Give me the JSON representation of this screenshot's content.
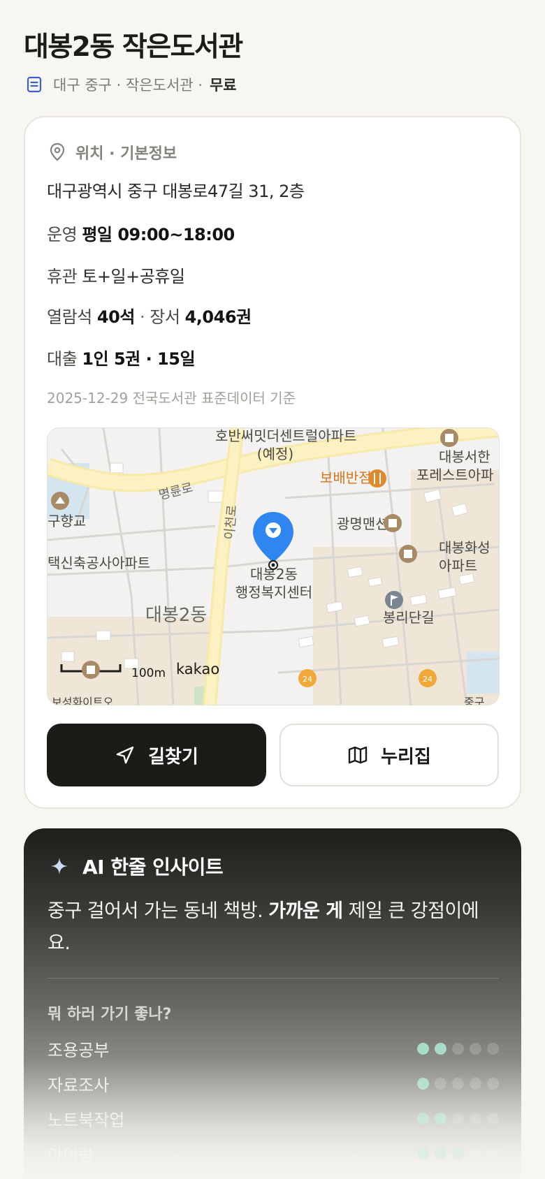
{
  "header": {
    "title": "대봉2동 작은도서관",
    "meta": "대구 중구 · 작은도서관 ·",
    "price": "무료"
  },
  "info": {
    "section_title": "위치 · 기본정보",
    "address": "대구광역시 중구 대봉로47길 31, 2층",
    "hours_label": "운영",
    "hours_value": "평일 09:00~18:00",
    "closed_label": "휴관",
    "closed_value": "토+일+공휴일",
    "seats_label": "열람석",
    "seats_value": "40석",
    "sep": "·",
    "books_label": "장서",
    "books_value": "4,046권",
    "loan_label": "대출",
    "loan_value": "1인 5권 · 15일",
    "source": "2025-12-29 전국도서관 표준데이터 기준"
  },
  "map": {
    "labels": {
      "apt1a": "호반써밋더센트럴아파트",
      "apt1b": "(예정)",
      "daebong_seo_a": "대봉서한",
      "daebong_seo_b": "포레스트아파",
      "bobae": "보배반점",
      "myeongryun": "명륜로",
      "hyanggyo": "구향교",
      "icheon": "이천로",
      "gwangmyeong": "광명맨션",
      "hwaseong_a": "대봉화성",
      "hwaseong_b": "아파트",
      "housing": "택신축공사아파트",
      "center_a": "대봉2동",
      "center_b": "행정복지센터",
      "district": "대봉2동",
      "bongri": "봉리단길",
      "scale": "100m",
      "kakao": "kakao",
      "jung": "중구",
      "bottom_left": "보성화이트오"
    }
  },
  "actions": {
    "directions": "길찾기",
    "nurijip": "누리집"
  },
  "ai": {
    "title": "AI 한줄 인사이트",
    "body_prefix": "중구 걸어서 가는 동네 책방. ",
    "body_bold": "가까운 게",
    "body_suffix": " 제일 큰 강점이에요.",
    "question": "뭐 하러 가기 좋나?",
    "ratings": [
      {
        "label": "조용공부",
        "score": 2,
        "max": 5
      },
      {
        "label": "자료조사",
        "score": 1,
        "max": 5
      },
      {
        "label": "노트북작업",
        "score": 2,
        "max": 5
      },
      {
        "label": "아이랑",
        "score": 3,
        "max": 5
      }
    ]
  },
  "colors": {
    "accent_dark": "#1c1b18",
    "pin_blue": "#2f86f0",
    "dot_on": "#a9dcc8",
    "bobae_orange": "#d9761c"
  }
}
